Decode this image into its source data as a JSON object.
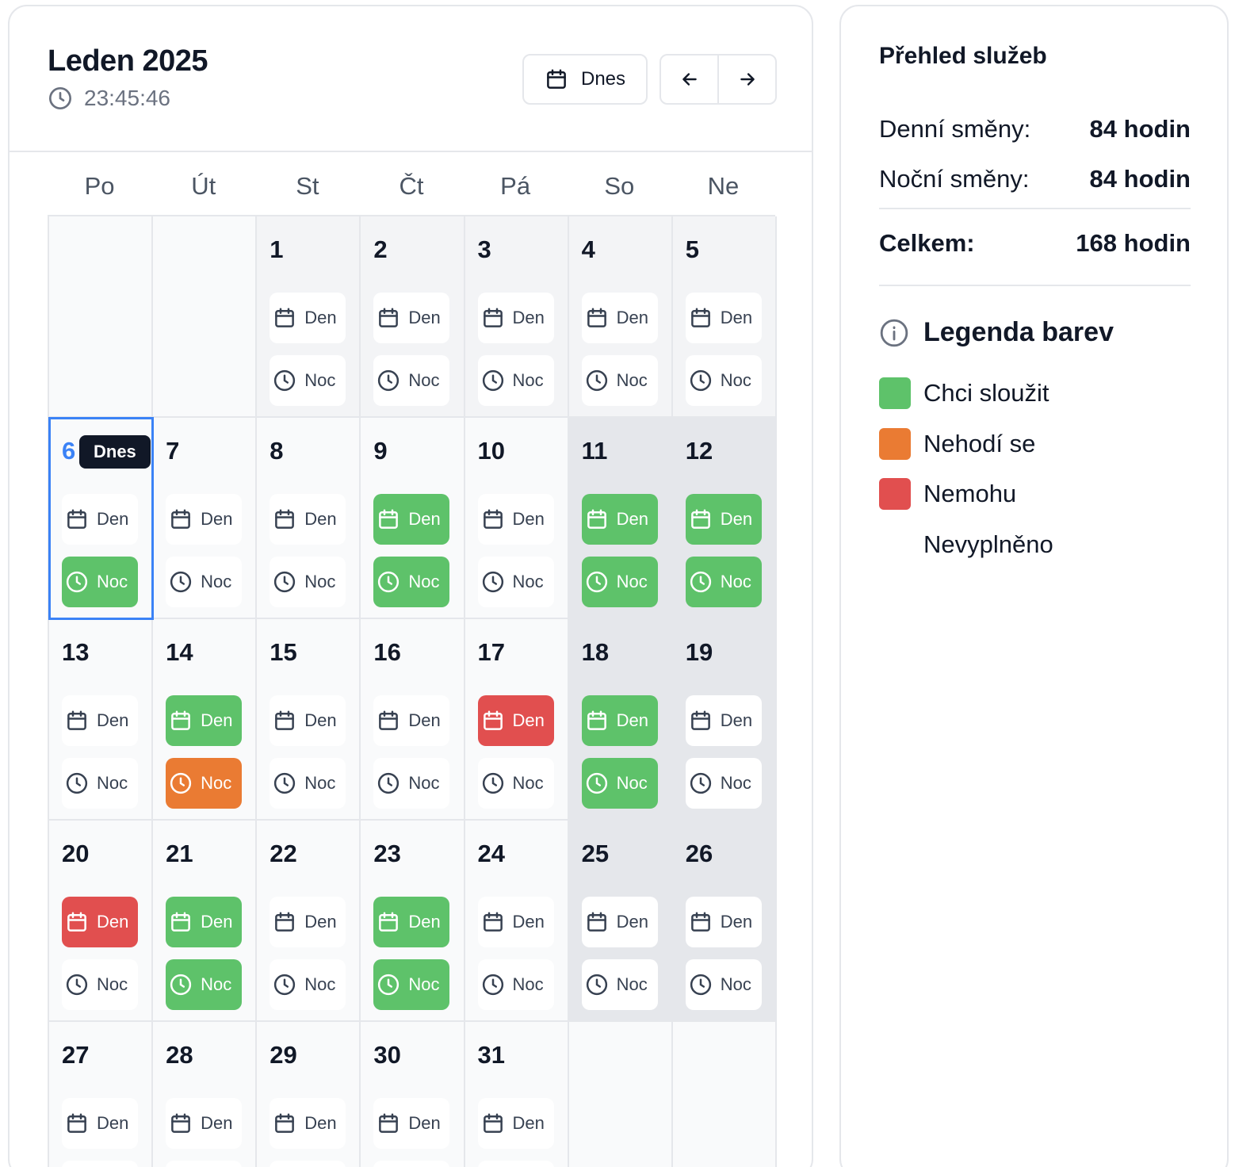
{
  "calendar": {
    "title": "Leden 2025",
    "clock_icon": "clock-icon",
    "time": "23:45:46",
    "today_button": "Dnes",
    "prev_icon": "arrow-left-icon",
    "next_icon": "arrow-right-icon",
    "weekdays": [
      "Po",
      "Út",
      "St",
      "Čt",
      "Pá",
      "So",
      "Ne"
    ],
    "shift_labels": {
      "day": "Den",
      "night": "Noc"
    },
    "today_tooltip": "Dnes",
    "colors": {
      "green": "#5ec26a",
      "orange": "#ea7b33",
      "red": "#e14f4f",
      "today_outline": "#3b82f6"
    },
    "days": [
      {
        "day": 1,
        "den": "none",
        "noc": "none"
      },
      {
        "day": 2,
        "den": "none",
        "noc": "none"
      },
      {
        "day": 3,
        "den": "none",
        "noc": "none"
      },
      {
        "day": 4,
        "den": "none",
        "noc": "none"
      },
      {
        "day": 5,
        "den": "none",
        "noc": "none"
      },
      {
        "day": 6,
        "den": "none",
        "noc": "green",
        "today": true
      },
      {
        "day": 7,
        "den": "none",
        "noc": "none"
      },
      {
        "day": 8,
        "den": "none",
        "noc": "none"
      },
      {
        "day": 9,
        "den": "green",
        "noc": "green"
      },
      {
        "day": 10,
        "den": "none",
        "noc": "none"
      },
      {
        "day": 11,
        "den": "green",
        "noc": "green"
      },
      {
        "day": 12,
        "den": "green",
        "noc": "green"
      },
      {
        "day": 13,
        "den": "none",
        "noc": "none"
      },
      {
        "day": 14,
        "den": "green",
        "noc": "orange"
      },
      {
        "day": 15,
        "den": "none",
        "noc": "none"
      },
      {
        "day": 16,
        "den": "none",
        "noc": "none"
      },
      {
        "day": 17,
        "den": "red",
        "noc": "none"
      },
      {
        "day": 18,
        "den": "green",
        "noc": "green"
      },
      {
        "day": 19,
        "den": "none",
        "noc": "none"
      },
      {
        "day": 20,
        "den": "red",
        "noc": "none"
      },
      {
        "day": 21,
        "den": "green",
        "noc": "green"
      },
      {
        "day": 22,
        "den": "none",
        "noc": "none"
      },
      {
        "day": 23,
        "den": "green",
        "noc": "green"
      },
      {
        "day": 24,
        "den": "none",
        "noc": "none"
      },
      {
        "day": 25,
        "den": "none",
        "noc": "none"
      },
      {
        "day": 26,
        "den": "none",
        "noc": "none"
      },
      {
        "day": 27,
        "den": "none",
        "noc": "none"
      },
      {
        "day": 28,
        "den": "none",
        "noc": "none"
      },
      {
        "day": 29,
        "den": "none",
        "noc": "none"
      },
      {
        "day": 30,
        "den": "none",
        "noc": "none"
      },
      {
        "day": 31,
        "den": "none",
        "noc": "none"
      }
    ]
  },
  "summary": {
    "title": "Přehled služeb",
    "rows": [
      {
        "label": "Denní směny:",
        "value": "84 hodin"
      },
      {
        "label": "Noční směny:",
        "value": "84 hodin"
      }
    ],
    "total_label": "Celkem:",
    "total_value": "168 hodin",
    "legend_icon": "info-icon",
    "legend_title": "Legenda barev",
    "legend": [
      {
        "label": "Chci sloužit",
        "color": "#5ec26a"
      },
      {
        "label": "Nehodí se",
        "color": "#ea7b33"
      },
      {
        "label": "Nemohu",
        "color": "#e14f4f"
      },
      {
        "label": "Nevyplněno",
        "color": "transparent"
      }
    ]
  }
}
